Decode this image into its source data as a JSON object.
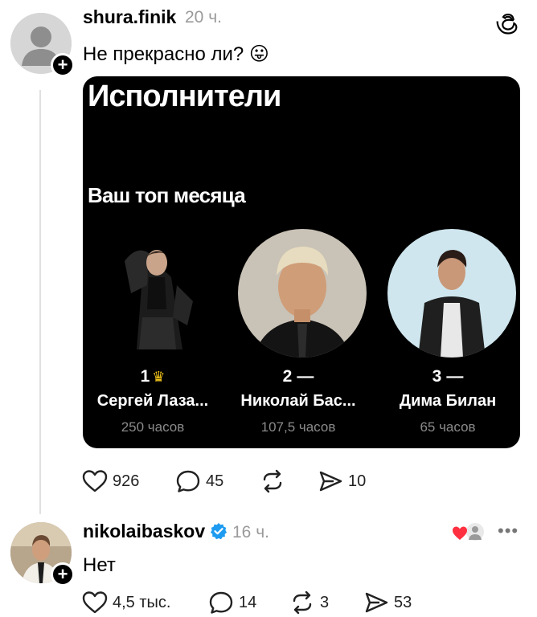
{
  "post": {
    "username": "shura.finik",
    "time": "20 ч.",
    "text": "Не прекрасно ли? 😛",
    "card": {
      "title": "Исполнители",
      "subtitle": "Ваш топ месяца",
      "artists": [
        {
          "rank": "1",
          "badge": "crown",
          "name": "Сергей Лаза...",
          "hours": "250 часов"
        },
        {
          "rank": "2",
          "badge": "—",
          "name": "Николай Бас...",
          "hours": "107,5 часов"
        },
        {
          "rank": "3",
          "badge": "—",
          "name": "Дима Билан",
          "hours": "65 часов"
        }
      ]
    },
    "stats": {
      "likes": "926",
      "comments": "45",
      "reposts": "",
      "shares": "10"
    }
  },
  "reply": {
    "username": "nikolaibaskov",
    "verified": true,
    "time": "16 ч.",
    "text": "Нет",
    "stats": {
      "likes": "4,5 тыс.",
      "comments": "14",
      "reposts": "3",
      "shares": "53"
    }
  },
  "colors": {
    "accent_verified": "#1d9bf0",
    "heart": "#ff3040",
    "crown": "#f5c518"
  }
}
